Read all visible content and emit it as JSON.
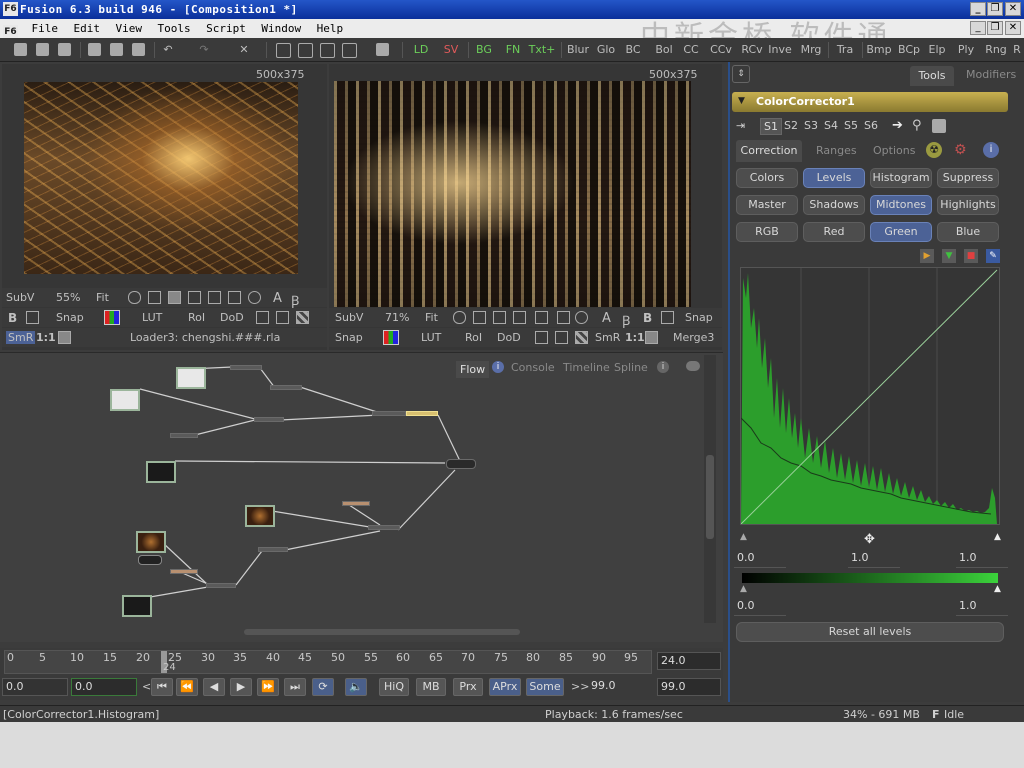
{
  "window": {
    "title": "Fusion 6.3 build 946 - [Composition1 *]",
    "app_icon": "F6",
    "watermark": "中新金桥 软件通"
  },
  "menu": [
    "File",
    "Edit",
    "View",
    "Tools",
    "Script",
    "Window",
    "Help"
  ],
  "toolbar": {
    "tools": [
      "LD",
      "SV",
      "BG",
      "FN",
      "Txt+",
      "Blur",
      "Glo",
      "BC",
      "Bol",
      "CC",
      "CCv",
      "RCv",
      "Inve",
      "Mrg",
      "Tra",
      "Bmp",
      "BCp",
      "Elp",
      "Ply",
      "Rng",
      "R"
    ]
  },
  "viewer_left": {
    "resolution": "500x375",
    "row1": {
      "mode": "SubV",
      "zoom": "55%",
      "fit": "Fit"
    },
    "row2": {
      "b": "B",
      "snap": "Snap",
      "lut": "LUT",
      "roi": "RoI",
      "dod": "DoD"
    },
    "row3": {
      "smr": "SmR",
      "ratio": "1:1",
      "loader": "Loader3: chengshi.###.rla"
    }
  },
  "viewer_right": {
    "resolution": "500x375",
    "row1": {
      "mode": "SubV",
      "zoom": "71%",
      "fit": "Fit",
      "b": "B",
      "snap": "Snap"
    },
    "row2": {
      "snap": "Snap",
      "lut": "LUT",
      "roi": "RoI",
      "dod": "DoD",
      "smr": "SmR",
      "ratio": "1:1",
      "merge": "Merge3"
    }
  },
  "flow_tabs": [
    "Flow",
    "Console",
    "Timeline",
    "Spline"
  ],
  "timeline": {
    "ticks": [
      "0",
      "5",
      "10",
      "15",
      "20",
      "25",
      "30",
      "35",
      "40",
      "45",
      "50",
      "55",
      "60",
      "65",
      "70",
      "75",
      "80",
      "85",
      "90",
      "95"
    ],
    "current_marker": "24",
    "end_field": "24.0",
    "start_field": "0.0",
    "start_field2": "0.0",
    "buttons": [
      "HiQ",
      "MB",
      "Prx",
      "APrx",
      "Some"
    ],
    "render_end": "99.0",
    "global_end": "99.0"
  },
  "right_panel": {
    "tabs": [
      "Tools",
      "Modifiers"
    ],
    "tool_name": "ColorCorrector1",
    "versions": [
      "S1",
      "S2",
      "S3",
      "S4",
      "S5",
      "S6"
    ],
    "sub_tabs": [
      "Correction",
      "Ranges",
      "Options"
    ],
    "mode_buttons": [
      "Colors",
      "Levels",
      "Histogram",
      "Suppress"
    ],
    "range_buttons": [
      "Master",
      "Shadows",
      "Midtones",
      "Highlights"
    ],
    "channel_buttons": [
      "RGB",
      "Red",
      "Green",
      "Blue"
    ],
    "levels": {
      "in_low": "0.0",
      "gamma": "1.0",
      "in_high": "1.0",
      "out_low": "0.0",
      "out_high": "1.0"
    },
    "reset_label": "Reset all levels",
    "accent": "#4c6296",
    "histogram_color": "#3bd23b"
  },
  "status": {
    "left": "[ColorCorrector1.Histogram]",
    "playback": "Playback: 1.6 frames/sec",
    "memory": "34% - 691 MB",
    "state": "Idle"
  }
}
